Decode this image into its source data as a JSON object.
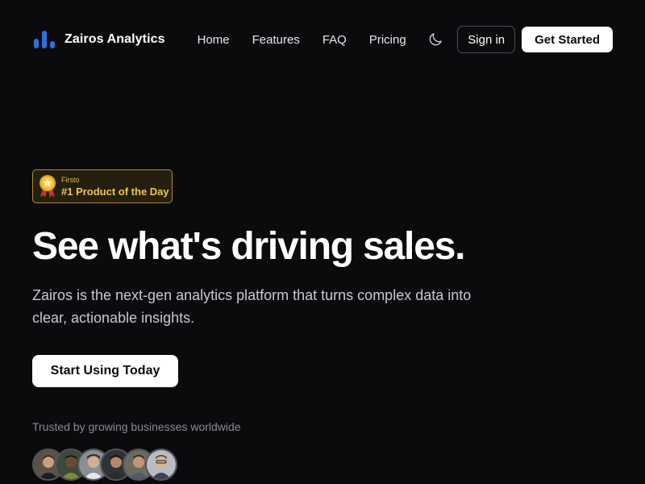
{
  "header": {
    "brand_name": "Zairos Analytics",
    "brand_icon": "bar-chart-logo-icon",
    "nav": [
      {
        "label": "Home"
      },
      {
        "label": "Features"
      },
      {
        "label": "FAQ"
      },
      {
        "label": "Pricing"
      }
    ],
    "theme_icon": "moon-icon",
    "sign_in_label": "Sign in",
    "get_started_label": "Get Started"
  },
  "badge": {
    "icon": "medal-icon",
    "small_text": "Firsto",
    "big_text": "#1 Product of the Day"
  },
  "hero": {
    "title": "See what's driving sales.",
    "description": "Zairos is the next-gen analytics platform that turns complex data into clear, actionable insights.",
    "cta_label": "Start Using Today"
  },
  "social_proof": {
    "text": "Trusted by growing businesses worldwide",
    "avatar_count": 6
  },
  "colors": {
    "background": "#0b0b0e",
    "brand_blue": "#2f6fe0",
    "badge_gold": "#f1c550",
    "muted_text": "#8a8a94"
  }
}
